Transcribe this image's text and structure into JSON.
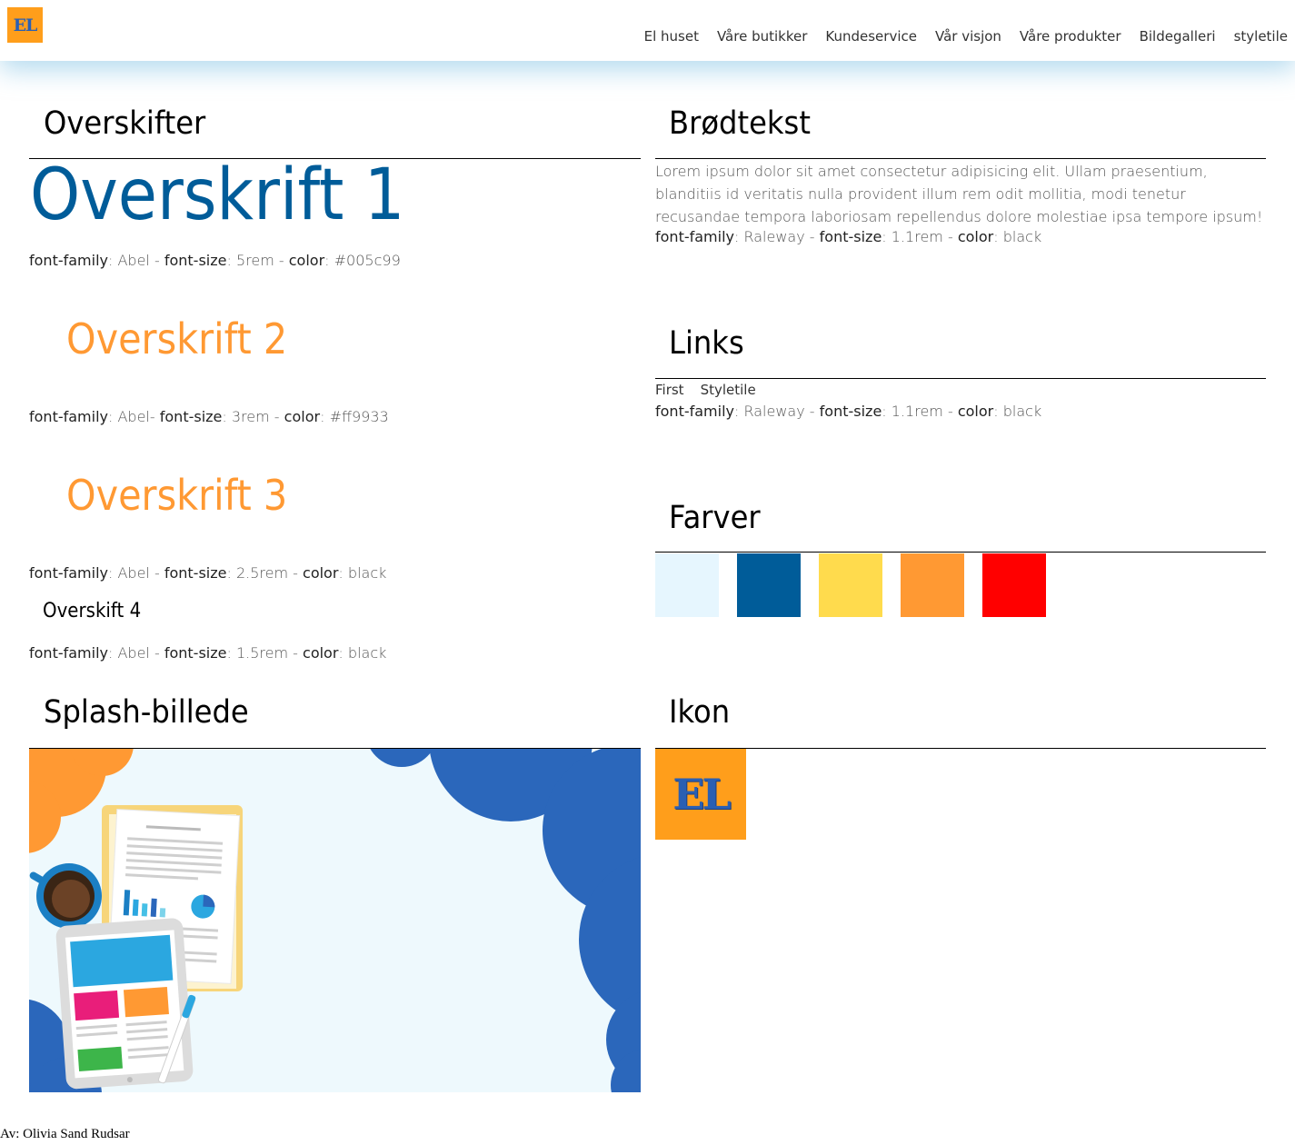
{
  "header": {
    "logo_text": "EL",
    "nav": [
      "El huset",
      "Våre butikker",
      "Kundeservice",
      "Vår visjon",
      "Våre produkter",
      "Bildegalleri",
      "styletile"
    ]
  },
  "headings_section": {
    "title": "Overskifter",
    "h1": {
      "text": "Overskrift 1",
      "meta_family_label": "font-family",
      "meta_family": "Abel",
      "meta_size_label": "font-size",
      "meta_size": "5rem",
      "meta_color_label": "color",
      "meta_color": "#005c99"
    },
    "h2": {
      "text": "Overskrift 2",
      "meta_family_label": "font-family",
      "meta_family": "Abel-",
      "meta_size_label": "font-size",
      "meta_size": "3rem",
      "meta_color_label": "color",
      "meta_color": "#ff9933"
    },
    "h3": {
      "text": "Overskrift 3",
      "meta_family_label": "font-family",
      "meta_family": "Abel",
      "meta_size_label": "font-size",
      "meta_size": "2.5rem",
      "meta_color_label": "color",
      "meta_color": "black"
    },
    "h4": {
      "text": "Overskift 4",
      "meta_family_label": "font-family",
      "meta_family": "Abel",
      "meta_size_label": "font-size",
      "meta_size": "1.5rem",
      "meta_color_label": "color",
      "meta_color": "black"
    }
  },
  "body_section": {
    "title": "Brødtekst",
    "text": "Lorem ipsum dolor sit amet consectetur adipisicing elit. Ullam praesentium, blanditiis id veritatis nulla provident illum rem odit mollitia, modi tenetur recusandae tempora laboriosam repellendus dolore molestiae ipsa tempore ipsum!",
    "meta_family_label": "font-family",
    "meta_family": "Raleway",
    "meta_size_label": "font-size",
    "meta_size": "1.1rem",
    "meta_color_label": "color",
    "meta_color": "black"
  },
  "links_section": {
    "title": "Links",
    "links": [
      "First",
      "Styletile"
    ],
    "meta_family_label": "font-family",
    "meta_family": "Raleway",
    "meta_size_label": "font-size",
    "meta_size": "1.1rem",
    "meta_color_label": "color",
    "meta_color": "black"
  },
  "colors_section": {
    "title": "Farver",
    "swatches": [
      "#e6f6fe",
      "#005c99",
      "#ffdb4d",
      "#ff9933",
      "#ff0000"
    ]
  },
  "splash_section": {
    "title": "Splash-billede"
  },
  "icon_section": {
    "title": "Ikon",
    "icon_text": "EL"
  },
  "footer": {
    "text": "Av: Olivia Sand Rudsar"
  }
}
